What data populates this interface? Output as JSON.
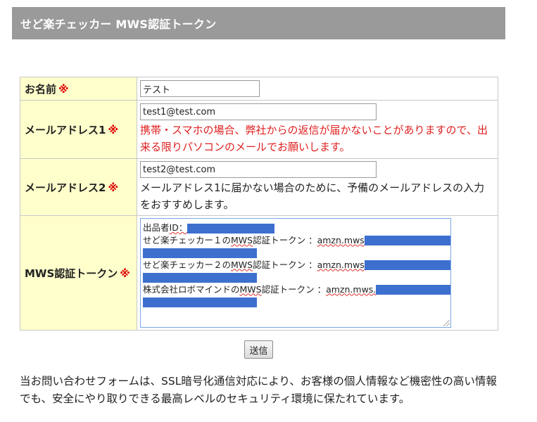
{
  "header": {
    "title": "せど楽チェッカー MWS認証トークン"
  },
  "form": {
    "required_mark": "※",
    "name": {
      "label": "お名前",
      "value": "テスト"
    },
    "email1": {
      "label": "メールアドレス1",
      "value": "test1@test.com",
      "note": "携帯・スマホの場合、弊社からの返信が届かないことがありますので、出来る限りパソコンのメールでお願いします。"
    },
    "email2": {
      "label": "メールアドレス2",
      "value": "test2@test.com",
      "note": "メールアドレス1に届かない場合のために、予備のメールアドレスの入力をおすすめします。"
    },
    "mws_token": {
      "label": "MWS認証トークン",
      "lines": {
        "seller_id_label": "出品者",
        "seller_id_key": "ID",
        "seller_id_colon": "：",
        "token1_prefix": "せど楽チェッカー１の",
        "token1_mws": "MWS",
        "token1_suffix": "認証トークン ：",
        "token1_value": "amzn.mws",
        "token2_prefix": "せど楽チェッカー２の",
        "token2_mws": "MWS",
        "token2_suffix": "認証トークン ：",
        "token2_value": "amzn.mws",
        "token3_prefix": "株式会社ロボマインドの",
        "token3_mws": "MWS",
        "token3_suffix": "認証トークン ：",
        "token3_value": "amzn.mws."
      }
    },
    "submit_label": "送信"
  },
  "footer": {
    "security_notice": "当お問い合わせフォームは、SSL暗号化通信対応により、お客様の個人情報など機密性の高い情報でも、安全にやり取りできる最高レベルのセキュリティ環境に保たれています。"
  },
  "colors": {
    "header_bg": "#9a9a9a",
    "label_bg": "#ffffcc",
    "required": "#dd0000",
    "warning_text": "#e02020",
    "redaction": "#3d6fcf"
  }
}
